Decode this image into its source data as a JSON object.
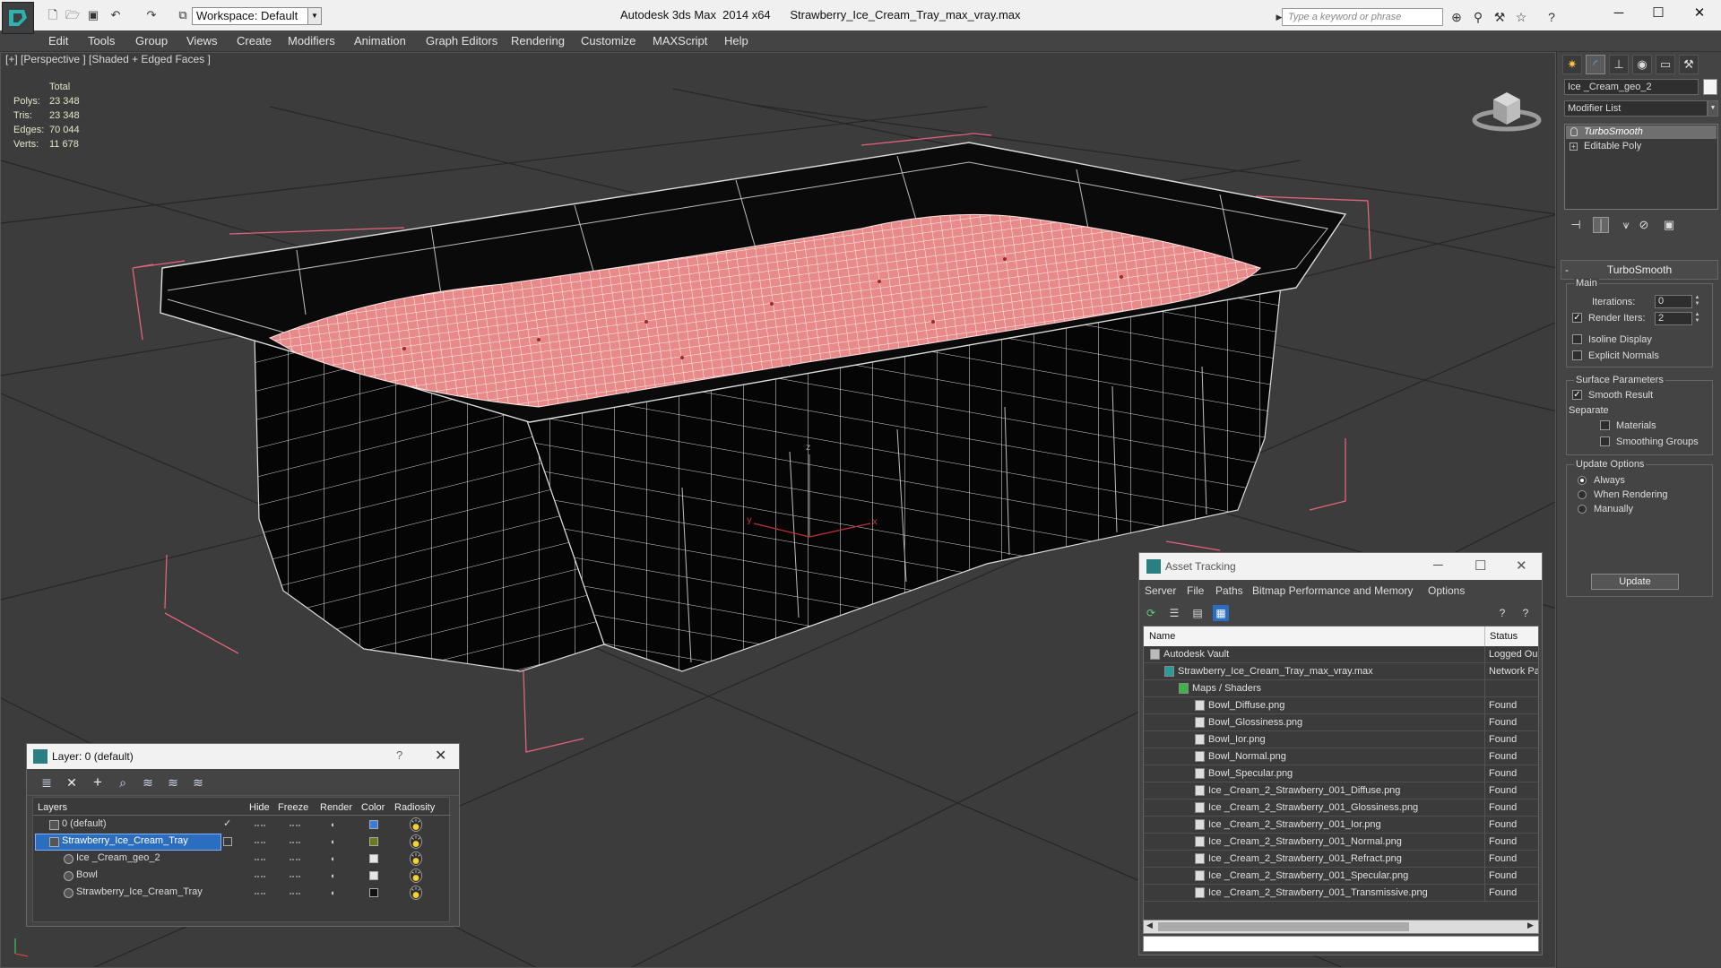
{
  "app": {
    "title": "Autodesk 3ds Max  2014 x64",
    "file": "Strawberry_Ice_Cream_Tray_max_vray.max",
    "workspace": "Workspace: Default",
    "search_placeholder": "Type a keyword or phrase"
  },
  "menu": [
    "Edit",
    "Tools",
    "Group",
    "Views",
    "Create",
    "Modifiers",
    "Animation",
    "Graph Editors",
    "Rendering",
    "Customize",
    "MAXScript",
    "Help"
  ],
  "viewport": {
    "label": "[+] [Perspective ] [Shaded + Edged Faces ]",
    "stats": {
      "header": "Total",
      "rows": [
        {
          "k": "Polys:",
          "v": "23 348"
        },
        {
          "k": "Tris:",
          "v": "23 348"
        },
        {
          "k": "Edges:",
          "v": "70 044"
        },
        {
          "k": "Verts:",
          "v": "11 678"
        }
      ]
    },
    "axis_labels": {
      "x": "x",
      "y": "y",
      "z": "z"
    }
  },
  "layer_dialog": {
    "title": "Layer: 0 (default)",
    "help": "?",
    "close": "✕",
    "columns": [
      "Layers",
      "Hide",
      "Freeze",
      "Render",
      "Color",
      "Radiosity"
    ],
    "rows": [
      {
        "name": "0 (default)",
        "color": "#3a7be0",
        "level": 0
      },
      {
        "name": "Strawberry_Ice_Cream_Tray",
        "color": "#6b7a1a",
        "level": 0
      },
      {
        "name": "Ice _Cream_geo_2",
        "color": "#e6e6e6",
        "level": 1
      },
      {
        "name": "Bowl",
        "color": "#e6e6e6",
        "level": 1
      },
      {
        "name": "Strawberry_Ice_Cream_Tray",
        "color": "#111111",
        "level": 1
      }
    ]
  },
  "asset_dialog": {
    "title": "Asset Tracking",
    "menu": [
      "Server",
      "File",
      "Paths",
      "Bitmap Performance and Memory",
      "Options"
    ],
    "columns": [
      "Name",
      "Status"
    ],
    "rows": [
      {
        "name": "Autodesk Vault",
        "status": "Logged Ou",
        "level": 1
      },
      {
        "name": "Strawberry_Ice_Cream_Tray_max_vray.max",
        "status": "Network Pa",
        "level": 2
      },
      {
        "name": "Maps / Shaders",
        "status": "",
        "level": 3
      },
      {
        "name": "Bowl_Diffuse.png",
        "status": "Found",
        "level": 4
      },
      {
        "name": "Bowl_Glossiness.png",
        "status": "Found",
        "level": 4
      },
      {
        "name": "Bowl_Ior.png",
        "status": "Found",
        "level": 4
      },
      {
        "name": "Bowl_Normal.png",
        "status": "Found",
        "level": 4
      },
      {
        "name": "Bowl_Specular.png",
        "status": "Found",
        "level": 4
      },
      {
        "name": "Ice _Cream_2_Strawberry_001_Diffuse.png",
        "status": "Found",
        "level": 4
      },
      {
        "name": "Ice _Cream_2_Strawberry_001_Glossiness.png",
        "status": "Found",
        "level": 4
      },
      {
        "name": "Ice _Cream_2_Strawberry_001_Ior.png",
        "status": "Found",
        "level": 4
      },
      {
        "name": "Ice _Cream_2_Strawberry_001_Normal.png",
        "status": "Found",
        "level": 4
      },
      {
        "name": "Ice _Cream_2_Strawberry_001_Refract.png",
        "status": "Found",
        "level": 4
      },
      {
        "name": "Ice _Cream_2_Strawberry_001_Specular.png",
        "status": "Found",
        "level": 4
      },
      {
        "name": "Ice _Cream_2_Strawberry_001_Transmissive.png",
        "status": "Found",
        "level": 4
      }
    ]
  },
  "command_panel": {
    "object_name": "Ice _Cream_geo_2",
    "modifier_list": "Modifier List",
    "stack": [
      "TurboSmooth",
      "Editable Poly"
    ],
    "rollout": "TurboSmooth",
    "main_label": "Main",
    "iterations_label": "Iterations:",
    "iterations": "0",
    "render_iters_label": "Render Iters:",
    "render_iters": "2",
    "isoline": "Isoline Display",
    "explicit_normals": "Explicit Normals",
    "surface_params": "Surface Parameters",
    "smooth_result": "Smooth Result",
    "separate": "Separate",
    "materials": "Materials",
    "smoothing_groups": "Smoothing Groups",
    "update_options": "Update Options",
    "always": "Always",
    "when_rendering": "When Rendering",
    "manually": "Manually",
    "update_button": "Update"
  }
}
